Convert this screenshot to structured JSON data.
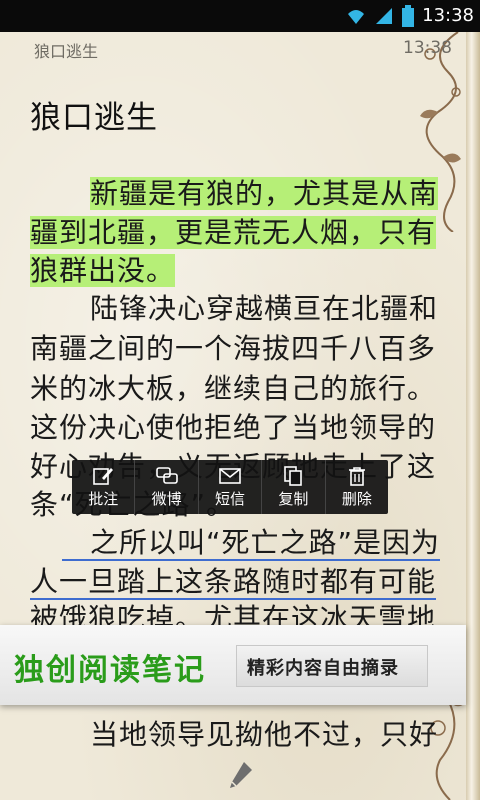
{
  "status_bar": {
    "time": "13:38"
  },
  "header": {
    "book_title": "狼口逃生",
    "time": "13:38"
  },
  "chapter": {
    "title": "狼口逃生"
  },
  "body_lines": [
    "新疆是有狼的，尤其是从南",
    "疆到北疆，更是荒无人烟，只有",
    "狼群出没。",
    "陆锋决心穿越横亘在北疆和",
    "南疆之间的一个海拔四千八百多",
    "米的冰大板，继续自己的旅行。",
    "这份决心使他拒绝了当地领导的",
    "好心劝告，义无返顾地走上了这",
    "条“死亡之路”。",
    "之所以叫“死亡之路”是因为",
    "人一旦踏上这条路随时都有可能",
    "被饿狼吃掉。尤其在这冰天雪地",
    "当地领导见拗他不过，只好"
  ],
  "popup_menu": {
    "items": [
      {
        "label": "批注",
        "icon": "edit-icon"
      },
      {
        "label": "微博",
        "icon": "chat-icon"
      },
      {
        "label": "短信",
        "icon": "mail-icon"
      },
      {
        "label": "复制",
        "icon": "copy-icon"
      },
      {
        "label": "删除",
        "icon": "trash-icon"
      }
    ]
  },
  "banner": {
    "title": "独创阅读笔记",
    "subtitle": "精彩内容自由摘录"
  },
  "colors": {
    "highlight": "#b6ef77",
    "underline": "#3e6ccf",
    "banner_green": "#2a9c1a",
    "page": "#efe9d9"
  }
}
